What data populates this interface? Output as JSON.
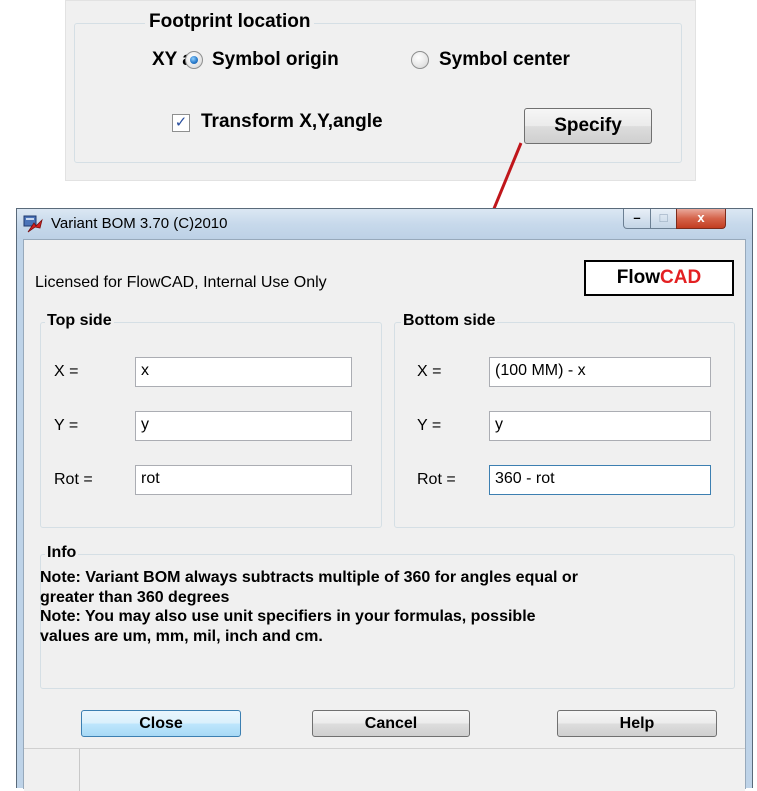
{
  "snippet": {
    "group_title": "Footprint location",
    "xy_label": "XY at",
    "radio_origin": "Symbol origin",
    "radio_center": "Symbol center",
    "selected_radio": "Symbol origin",
    "transform_label": "Transform X,Y,angle",
    "transform_checked": true,
    "checkmark": "✓",
    "specify_button": "Specify"
  },
  "window": {
    "title": "Variant BOM 3.70 (C)2010",
    "min_glyph": "–",
    "max_glyph": "□",
    "close_glyph": "x",
    "licensed_text": "Licensed for FlowCAD, Internal Use Only",
    "logo": {
      "part1": "Flow",
      "part2": "CAD",
      "part2_color": "#e32022"
    },
    "top_side": {
      "title": "Top side",
      "x_label": "X =",
      "x_value": "x",
      "y_label": "Y =",
      "y_value": "y",
      "rot_label": "Rot =",
      "rot_value": "rot"
    },
    "bottom_side": {
      "title": "Bottom side",
      "x_label": "X =",
      "x_value": "(100 MM) - x",
      "y_label": "Y =",
      "y_value": "y",
      "rot_label": "Rot =",
      "rot_value": "360 - rot"
    },
    "info": {
      "title": "Info",
      "lines": [
        "Note: Variant BOM always subtracts multiple of 360 for angles equal or",
        "greater than 360 degrees",
        "Note: You may also use unit specifiers in your formulas, possible",
        "values are um, mm, mil, inch and cm."
      ]
    },
    "buttons": {
      "close": "Close",
      "cancel": "Cancel",
      "help": "Help"
    }
  },
  "colors": {
    "arrow": "#c0161b",
    "accent": "#3c7fb1"
  }
}
